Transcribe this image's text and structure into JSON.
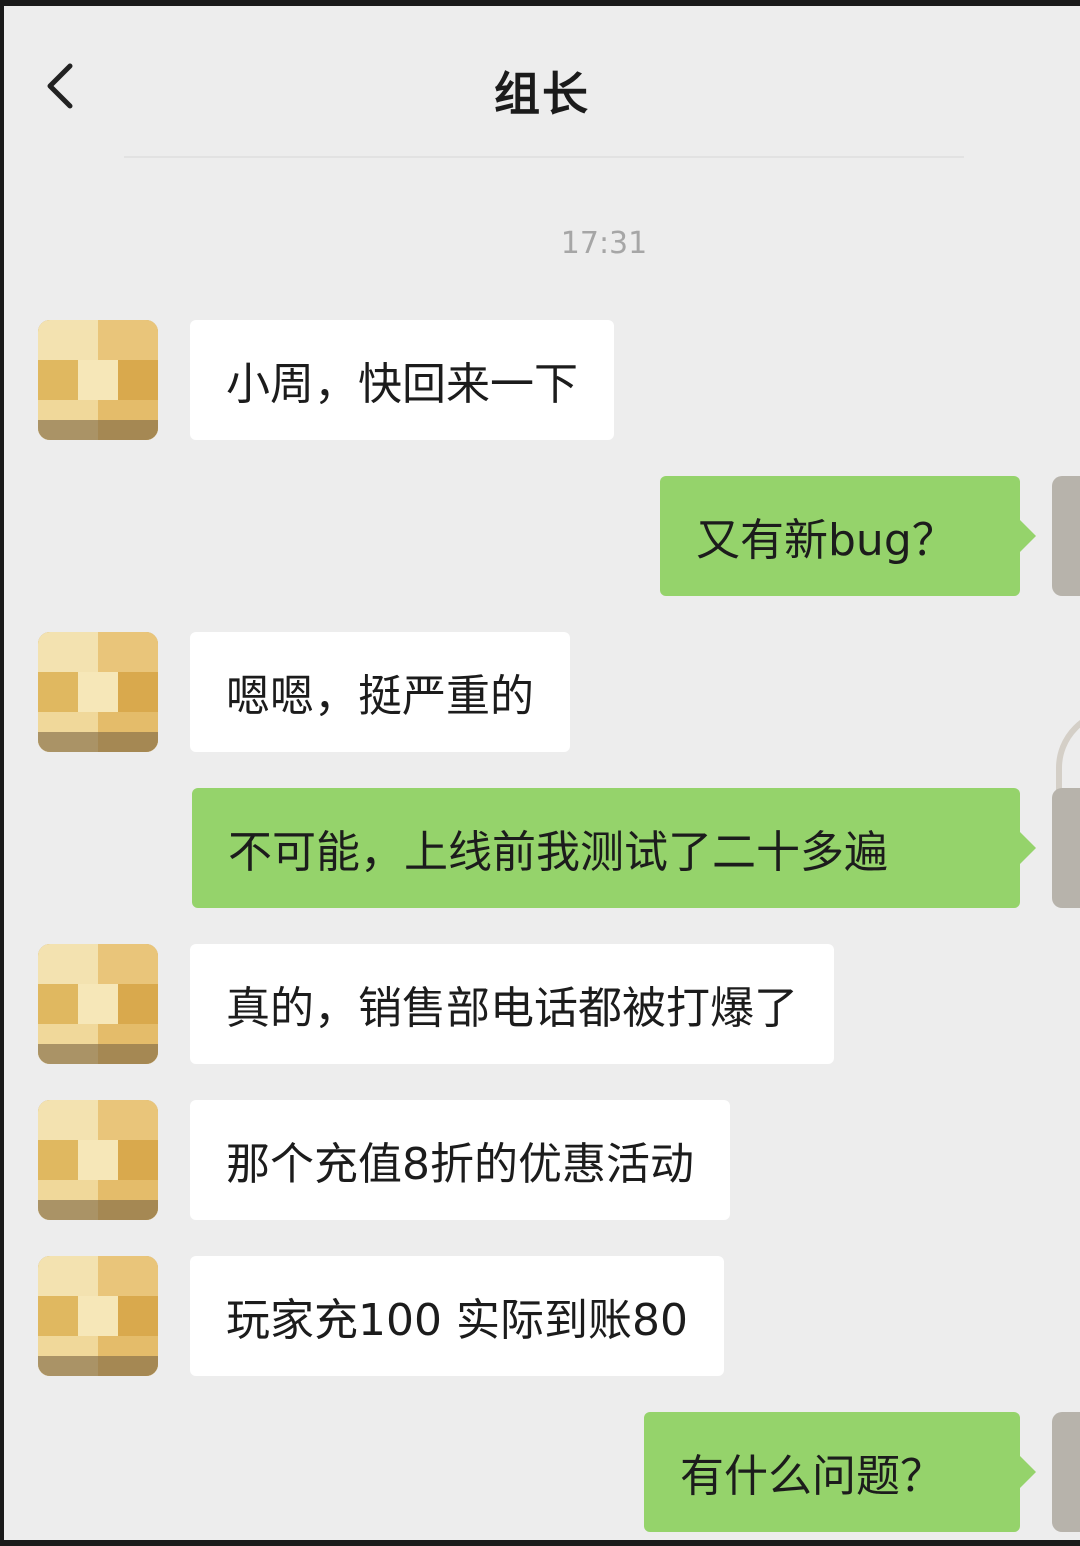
{
  "header": {
    "title": "组长",
    "back_icon": "chevron-left-icon"
  },
  "timestamp": "17:31",
  "colors": {
    "background": "#ededed",
    "bubble_incoming": "#ffffff",
    "bubble_outgoing": "#95d36b"
  },
  "messages": [
    {
      "side": "left",
      "text": "小周，快回来一下"
    },
    {
      "side": "right",
      "text": "又有新bug？"
    },
    {
      "side": "left",
      "text": "嗯嗯，挺严重的"
    },
    {
      "side": "right",
      "text": "不可能，上线前我测试了二十多遍"
    },
    {
      "side": "left",
      "text": "真的，销售部电话都被打爆了"
    },
    {
      "side": "left",
      "text": "那个充值8折的优惠活动"
    },
    {
      "side": "left",
      "text": "玩家充100 实际到账80"
    },
    {
      "side": "right",
      "text": "有什么问题？"
    }
  ]
}
